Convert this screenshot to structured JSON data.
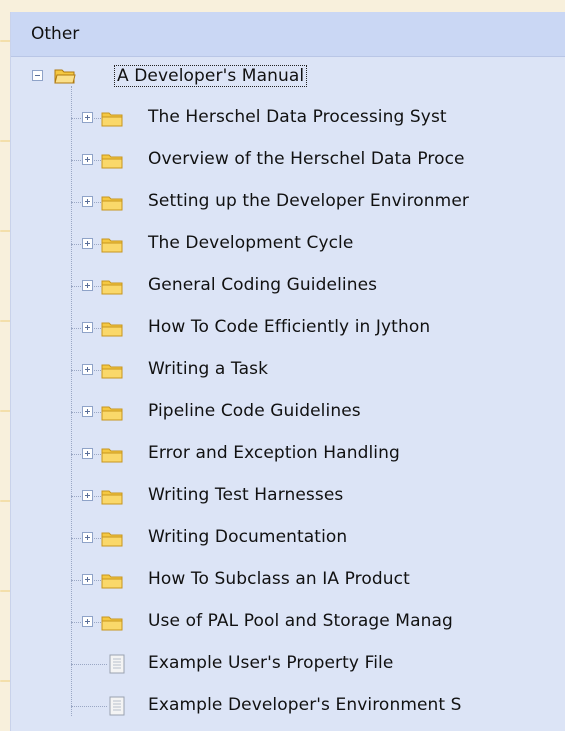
{
  "panel": {
    "title": "Other"
  },
  "tree": {
    "root": {
      "label": "A Developer's Manual",
      "icon": "open-folder-icon",
      "expanded": true
    },
    "folders": [
      "The Herschel Data Processing Syst",
      "Overview of the Herschel Data Proce",
      "Setting up the Developer Environmer",
      "The Development Cycle",
      "General Coding Guidelines",
      "How To Code Efficiently in Jython",
      "Writing a Task",
      "Pipeline Code Guidelines",
      "Error and Exception Handling",
      "Writing Test Harnesses",
      "Writing Documentation",
      "How To Subclass an IA Product",
      "Use of PAL Pool and Storage Manag"
    ],
    "documents": [
      "Example User's Property File",
      "Example Developer's Environment S"
    ]
  },
  "colors": {
    "panel_bg": "#dce4f6",
    "header_bg": "#cad7f4",
    "folder": "#f5c842",
    "folder_dark": "#c8961e",
    "page_bg": "#f8f0dc"
  },
  "icons": {
    "folder": "folder-icon",
    "open_folder": "open-folder-icon",
    "document": "document-icon",
    "expand": "plus-expander-icon",
    "collapse": "minus-expander-icon"
  }
}
